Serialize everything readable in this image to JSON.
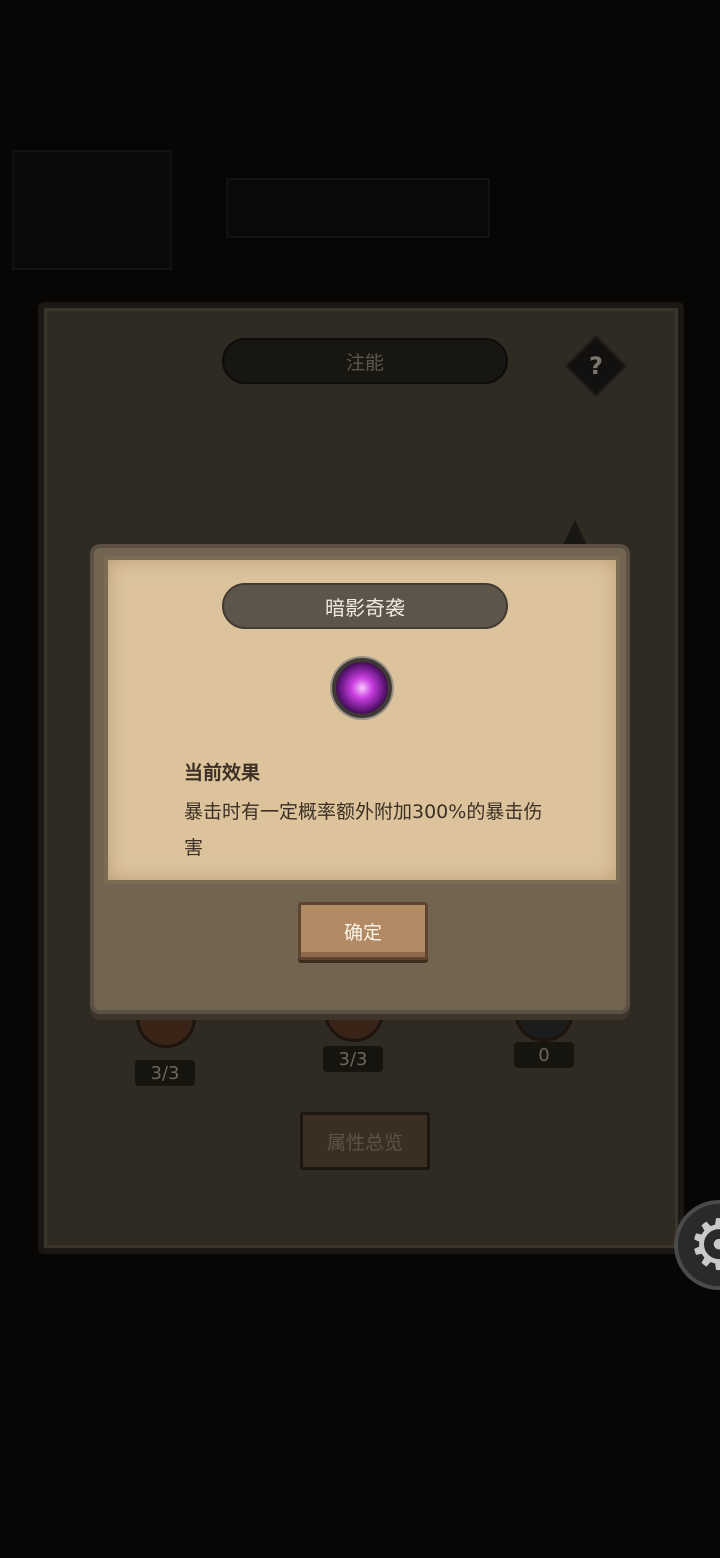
{
  "back_panel": {
    "title": "注能",
    "help_label": "?",
    "slots": [
      {
        "count": "3/3"
      },
      {
        "count": "3/3"
      },
      {
        "count": "0"
      }
    ],
    "overview_button": "属性总览"
  },
  "dialog": {
    "title": "暗影奇袭",
    "skill_icon": "shadow-orb-icon",
    "effect_heading": "当前效果",
    "effect_text": "暴击时有一定概率额外附加300%的暴击伤害",
    "confirm_label": "确定"
  },
  "settings_icon": "⚙"
}
